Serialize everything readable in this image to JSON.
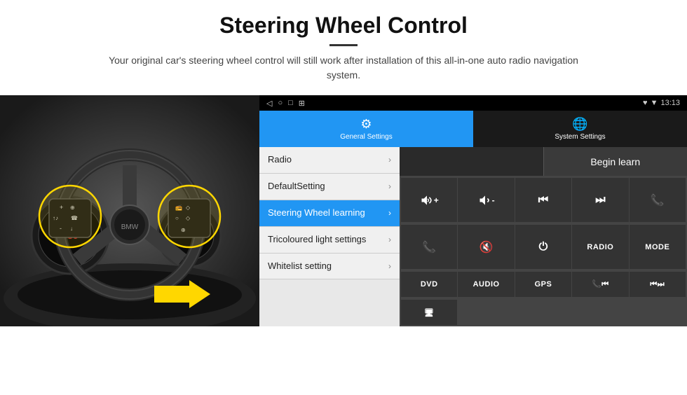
{
  "header": {
    "title": "Steering Wheel Control",
    "subtitle": "Your original car's steering wheel control will still work after installation of this all-in-one auto radio navigation system."
  },
  "status_bar": {
    "time": "13:13",
    "nav_icons": [
      "◁",
      "○",
      "□",
      "⊞"
    ],
    "right_icons": "♥ ▼ 13:13"
  },
  "tabs": [
    {
      "label": "General Settings",
      "icon": "⚙",
      "active": true
    },
    {
      "label": "System Settings",
      "icon": "🌐",
      "active": false
    }
  ],
  "menu": {
    "items": [
      {
        "label": "Radio",
        "active": false
      },
      {
        "label": "DefaultSetting",
        "active": false
      },
      {
        "label": "Steering Wheel learning",
        "active": true
      },
      {
        "label": "Tricoloured light settings",
        "active": false
      },
      {
        "label": "Whitelist setting",
        "active": false
      }
    ]
  },
  "right_panel": {
    "begin_learn_label": "Begin learn",
    "controls_row1": [
      "🔊+",
      "🔊-",
      "⏮",
      "⏭",
      "📞"
    ],
    "controls_row2": [
      "📞",
      "🔊x",
      "⏻",
      "RADIO",
      "MODE"
    ],
    "controls_row3": [
      "DVD",
      "AUDIO",
      "GPS",
      "📞⏮",
      "⏮⏭"
    ],
    "controls_row4": [
      "🖥"
    ]
  }
}
